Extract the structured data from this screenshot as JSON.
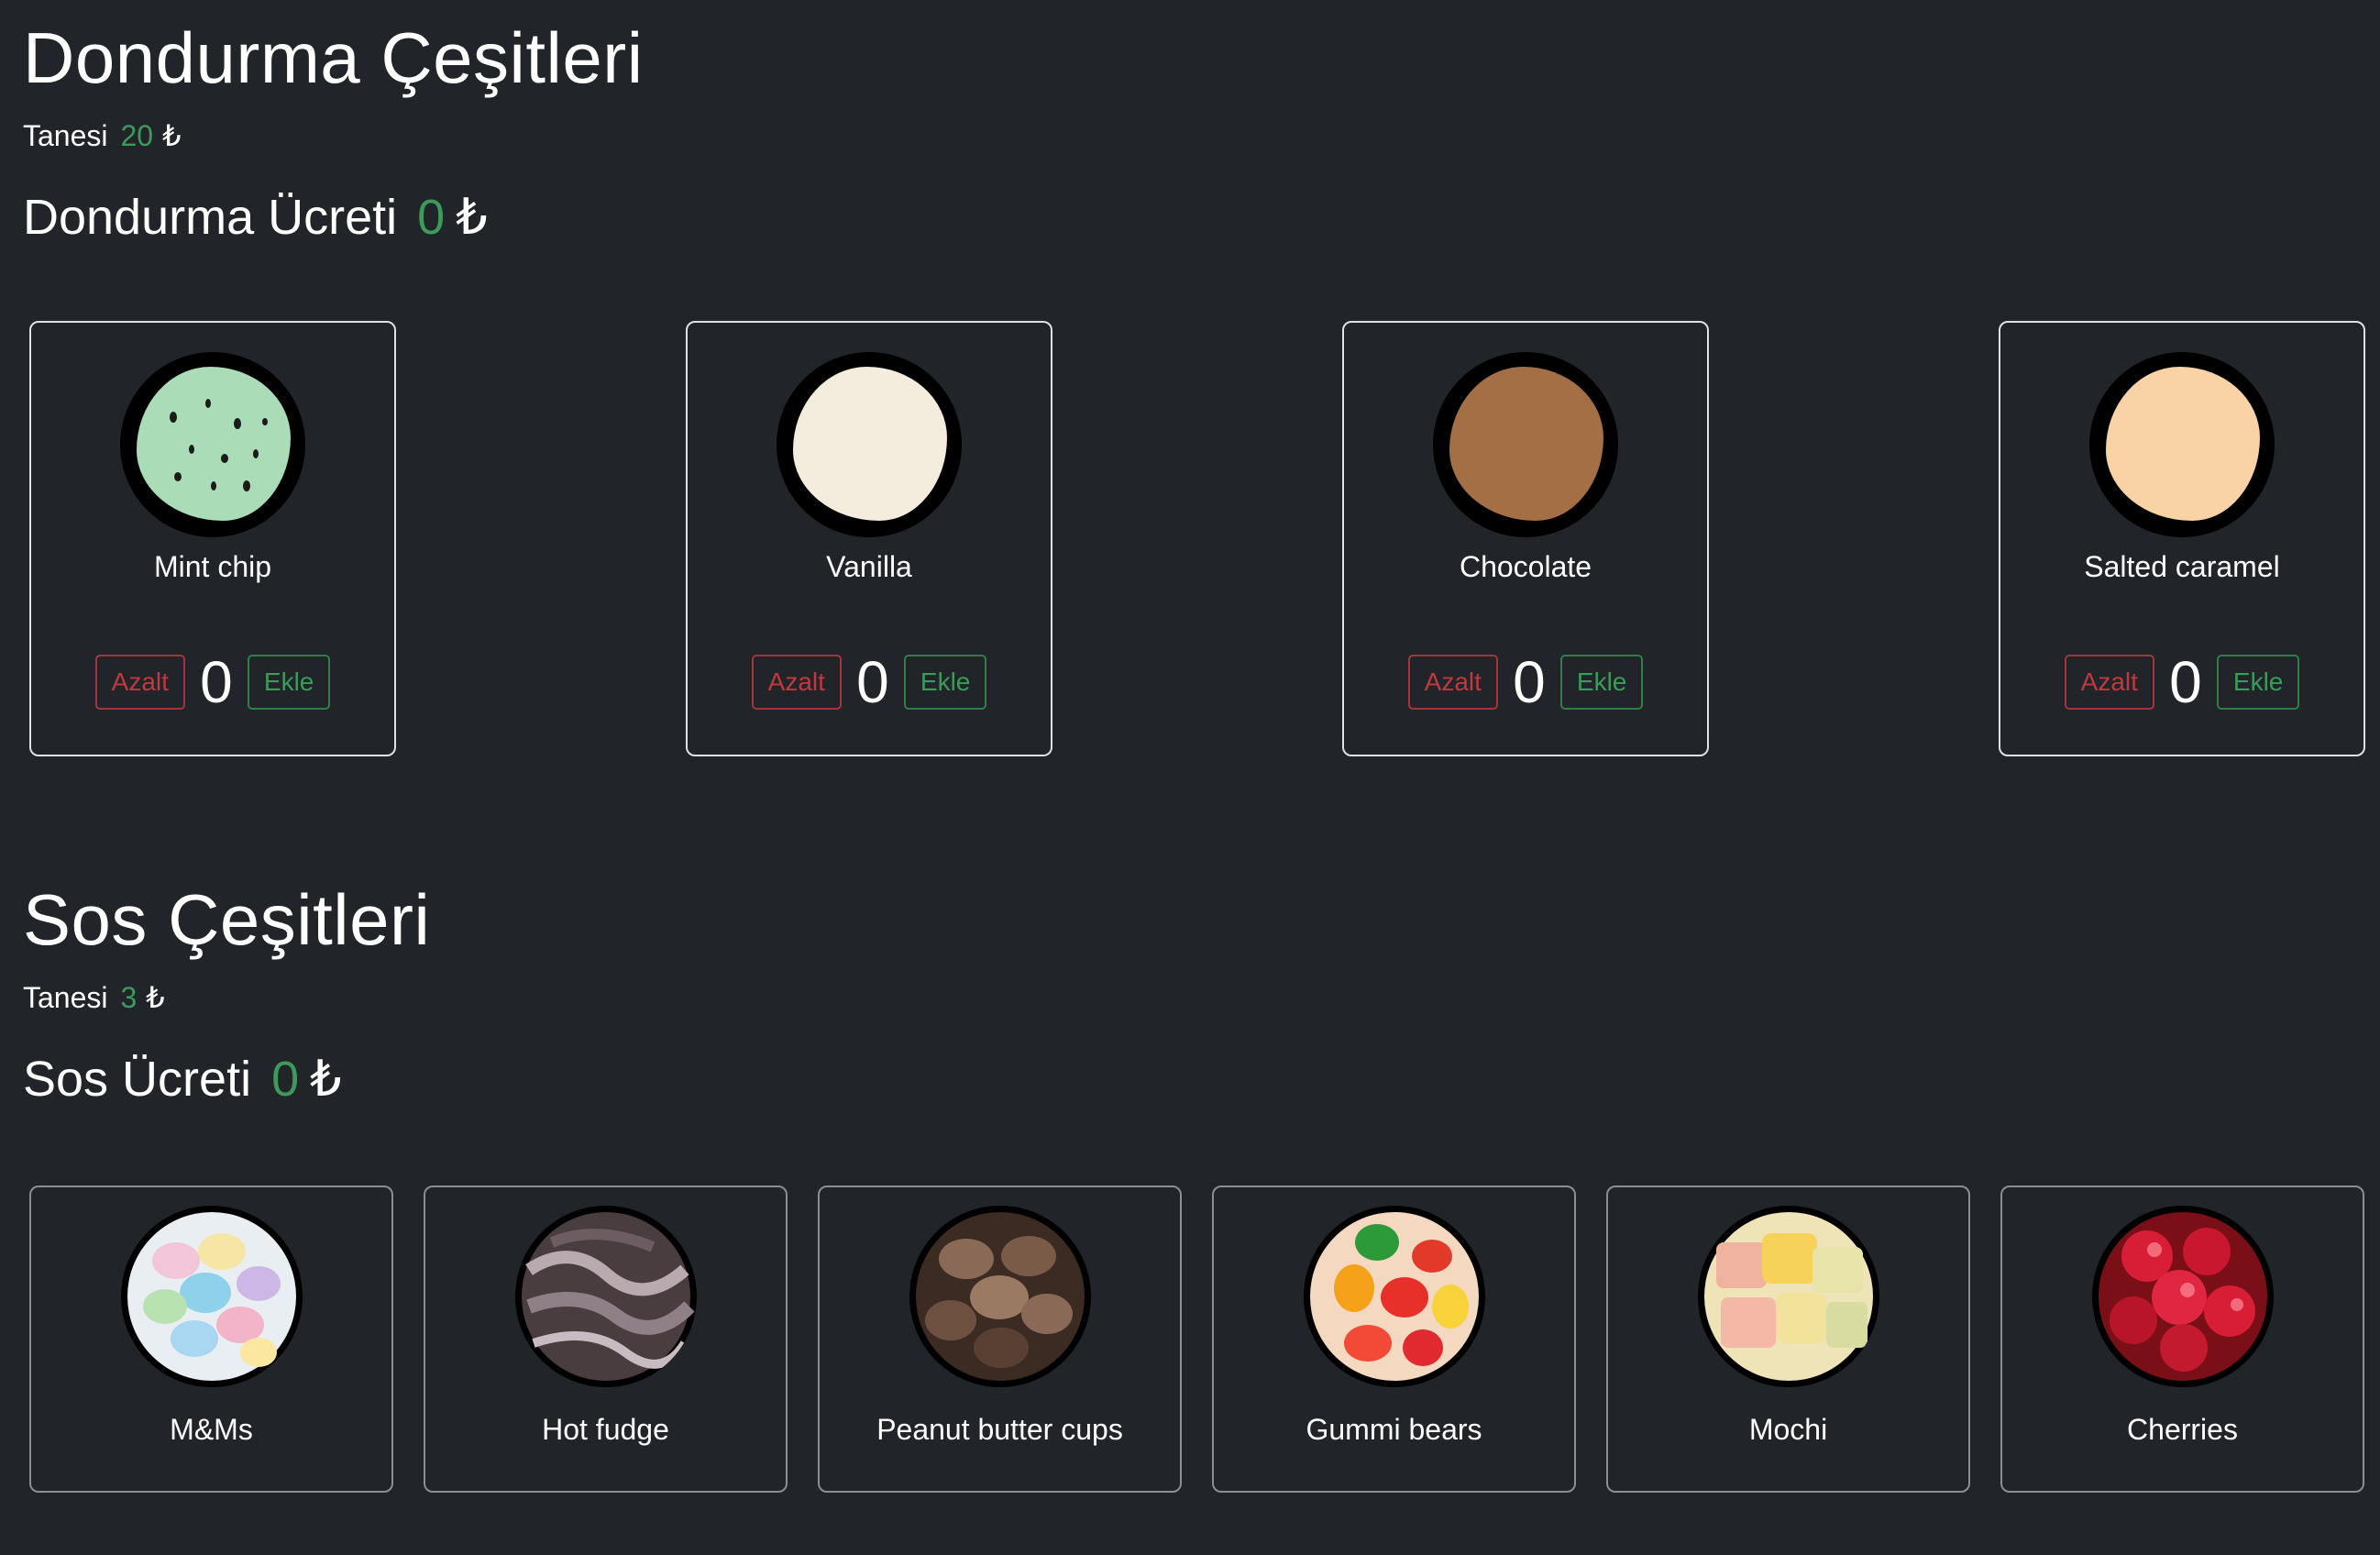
{
  "scoops": {
    "title": "Dondurma Çeşitleri",
    "unit_label": "Tanesi",
    "unit_price": "20",
    "currency": "₺",
    "total_label": "Dondurma Ücreti",
    "total_value": "0",
    "decrease_label": "Azalt",
    "increase_label": "Ekle",
    "items": [
      {
        "name": "Mint chip",
        "count": "0",
        "color": "#a9dcb7"
      },
      {
        "name": "Vanilla",
        "count": "0",
        "color": "#f4ecdc"
      },
      {
        "name": "Chocolate",
        "count": "0",
        "color": "#a56f45"
      },
      {
        "name": "Salted caramel",
        "count": "0",
        "color": "#f9d3a6"
      }
    ]
  },
  "toppings": {
    "title": "Sos Çeşitleri",
    "unit_label": "Tanesi",
    "unit_price": "3",
    "currency": "₺",
    "total_label": "Sos Ücreti",
    "total_value": "0",
    "items": [
      {
        "name": "M&Ms"
      },
      {
        "name": "Hot fudge"
      },
      {
        "name": "Peanut butter cups"
      },
      {
        "name": "Gummi bears"
      },
      {
        "name": "Mochi"
      },
      {
        "name": "Cherries"
      }
    ]
  }
}
